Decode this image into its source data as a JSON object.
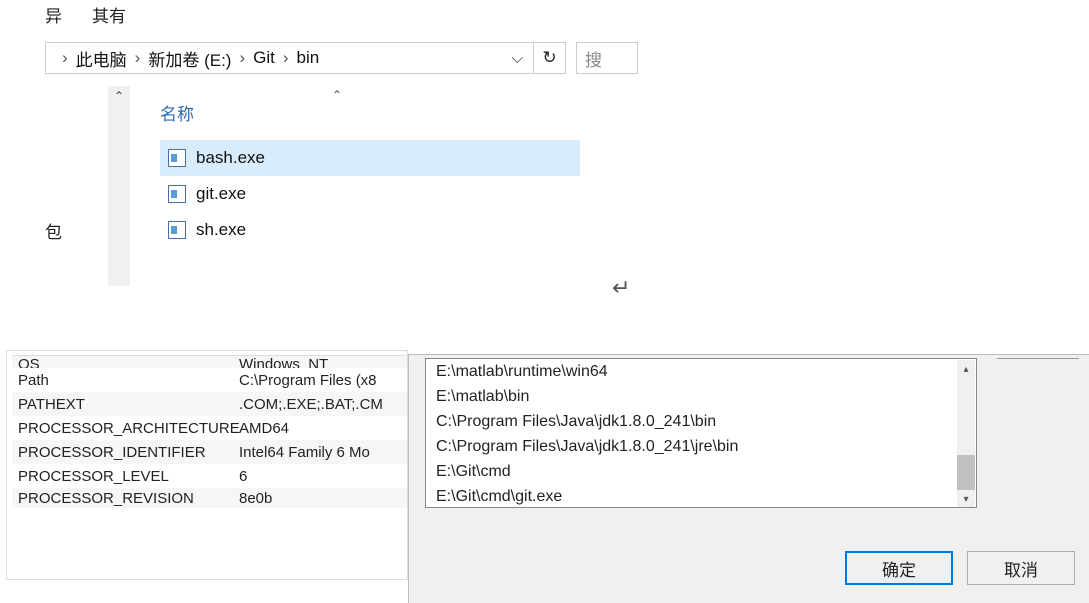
{
  "menu": {
    "item1": "异",
    "item2": "其有"
  },
  "breadcrumb": {
    "sep": "›",
    "item1": "此电脑",
    "item2": "新加卷 (E:)",
    "item3": "Git",
    "item4": "bin",
    "dropdown": "⌵"
  },
  "refresh": "↻",
  "search_placeholder": "搜",
  "sidebar_label": "包",
  "column_header": "名称",
  "sort_indicator": "⌃",
  "files": [
    {
      "name": "bash.exe",
      "selected": true
    },
    {
      "name": "git.exe",
      "selected": false
    },
    {
      "name": "sh.exe",
      "selected": false
    }
  ],
  "return_symbol": "↵",
  "env_vars": [
    {
      "key": "OS",
      "val": "Windows_NT",
      "cut_top": true
    },
    {
      "key": "Path",
      "val": "C:\\Program Files (x8"
    },
    {
      "key": "PATHEXT",
      "val": ".COM;.EXE;.BAT;.CM"
    },
    {
      "key": "PROCESSOR_ARCHITECTURE",
      "val": "AMD64"
    },
    {
      "key": "PROCESSOR_IDENTIFIER",
      "val": "Intel64 Family 6 Mo"
    },
    {
      "key": "PROCESSOR_LEVEL",
      "val": "6"
    },
    {
      "key": "PROCESSOR_REVISION",
      "val": "8e0b"
    }
  ],
  "path_entries": [
    "E:\\matlab\\runtime\\win64",
    "E:\\matlab\\bin",
    "C:\\Program Files\\Java\\jdk1.8.0_241\\bin",
    "C:\\Program Files\\Java\\jdk1.8.0_241\\jre\\bin",
    "E:\\Git\\cmd",
    "E:\\Git\\cmd\\git.exe"
  ],
  "dialog": {
    "ok": "确定",
    "cancel": "取消"
  }
}
